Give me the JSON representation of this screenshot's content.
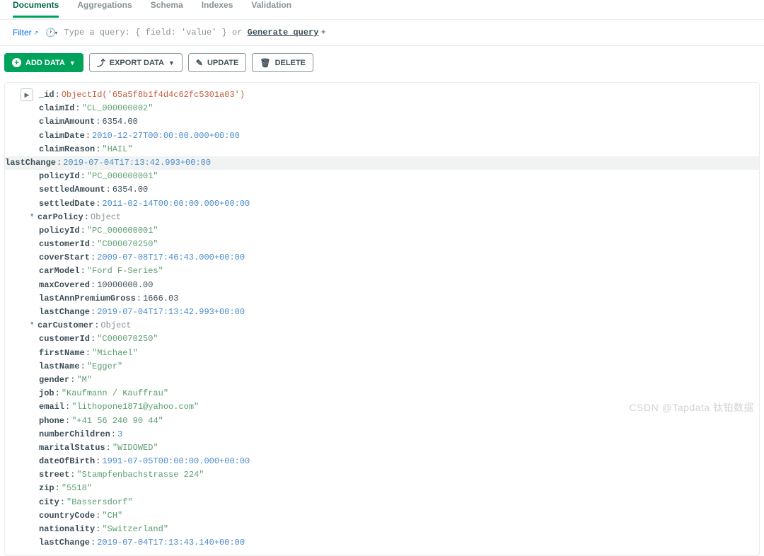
{
  "tabs": [
    {
      "label": "Documents",
      "active": true
    },
    {
      "label": "Aggregations",
      "active": false
    },
    {
      "label": "Schema",
      "active": false
    },
    {
      "label": "Indexes",
      "active": false
    },
    {
      "label": "Validation",
      "active": false
    }
  ],
  "query_bar": {
    "filter_label": "Filter",
    "placeholder": "Type a query: { field: 'value' } or ",
    "generate_label": "Generate query"
  },
  "actions": {
    "add_data": "ADD DATA",
    "export_data": "EXPORT DATA",
    "update": "UPDATE",
    "delete": "DELETE"
  },
  "doc": {
    "indent0": [
      {
        "key": "_id",
        "val": "ObjectId('65a5f8b1f4d4c62fc5301a03')",
        "cls": "v-oid"
      },
      {
        "key": "claimId",
        "val": "\"CL_000000002\"",
        "cls": "v-str"
      },
      {
        "key": "claimAmount",
        "val": "6354.00",
        "cls": "v-num"
      },
      {
        "key": "claimDate",
        "val": "2010-12-27T00:00:00.000+00:00",
        "cls": "v-date"
      },
      {
        "key": "claimReason",
        "val": "\"HAIL\"",
        "cls": "v-str"
      },
      {
        "key": "lastChange",
        "val": "2019-07-04T17:13:42.993+00:00",
        "cls": "v-date",
        "hl": true
      },
      {
        "key": "policyId",
        "val": "\"PC_000000001\"",
        "cls": "v-str"
      },
      {
        "key": "settledAmount",
        "val": "6354.00",
        "cls": "v-num"
      },
      {
        "key": "settledDate",
        "val": "2011-02-14T00:00:00.000+00:00",
        "cls": "v-date"
      }
    ],
    "carPolicy_key": "carPolicy",
    "carPolicy_type": "Object",
    "carPolicy": [
      {
        "key": "policyId",
        "val": "\"PC_000000001\"",
        "cls": "v-str"
      },
      {
        "key": "customerId",
        "val": "\"C000070250\"",
        "cls": "v-str"
      },
      {
        "key": "coverStart",
        "val": "2009-07-08T17:46:43.000+00:00",
        "cls": "v-date"
      },
      {
        "key": "carModel",
        "val": "\"Ford F-Series\"",
        "cls": "v-str"
      },
      {
        "key": "maxCovered",
        "val": "10000000.00",
        "cls": "v-num"
      },
      {
        "key": "lastAnnPremiumGross",
        "val": "1666.03",
        "cls": "v-num"
      },
      {
        "key": "lastChange",
        "val": "2019-07-04T17:13:42.993+00:00",
        "cls": "v-date"
      }
    ],
    "carCustomer_key": "carCustomer",
    "carCustomer_type": "Object",
    "carCustomer": [
      {
        "key": "customerId",
        "val": "\"C000070250\"",
        "cls": "v-str"
      },
      {
        "key": "firstName",
        "val": "\"Michael\"",
        "cls": "v-str"
      },
      {
        "key": "lastName",
        "val": "\"Egger\"",
        "cls": "v-str"
      },
      {
        "key": "gender",
        "val": "\"M\"",
        "cls": "v-str"
      },
      {
        "key": "job",
        "val": "\"Kaufmann / Kauffrau\"",
        "cls": "v-str"
      },
      {
        "key": "email",
        "val": "\"lithopone1871@yahoo.com\"",
        "cls": "v-str"
      },
      {
        "key": "phone",
        "val": "\"+41 56 240 90 44\"",
        "cls": "v-str"
      },
      {
        "key": "numberChildren",
        "val": "3",
        "cls": "v-date"
      },
      {
        "key": "maritalStatus",
        "val": "\"WIDOWED\"",
        "cls": "v-str"
      },
      {
        "key": "dateOfBirth",
        "val": "1991-07-05T00:00:00.000+00:00",
        "cls": "v-date"
      },
      {
        "key": "street",
        "val": "\"Stampfenbachstrasse 224\"",
        "cls": "v-str"
      },
      {
        "key": "zip",
        "val": "\"5518\"",
        "cls": "v-str"
      },
      {
        "key": "city",
        "val": "\"Bassersdorf\"",
        "cls": "v-str"
      },
      {
        "key": "countryCode",
        "val": "\"CH\"",
        "cls": "v-str"
      },
      {
        "key": "nationality",
        "val": "\"Switzerland\"",
        "cls": "v-str"
      },
      {
        "key": "lastChange",
        "val": "2019-07-04T17:13:43.140+00:00",
        "cls": "v-date"
      }
    ]
  },
  "watermark": "CSDN @Tapdata 钛铂数据"
}
